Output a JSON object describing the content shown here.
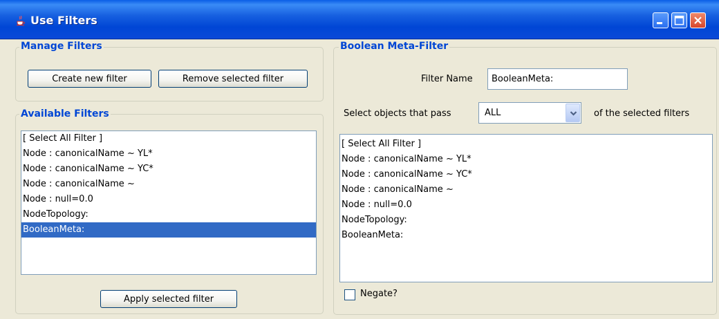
{
  "window": {
    "title": "Use Filters"
  },
  "manage_filters": {
    "title": "Manage Filters",
    "create_label": "Create new filter",
    "remove_label": "Remove selected filter"
  },
  "available_filters": {
    "title": "Available Filters",
    "items": [
      "[ Select All Filter ]",
      "Node : canonicalName ~ YL*",
      "Node : canonicalName ~ YC*",
      "Node : canonicalName ~",
      "Node : null=0.0",
      "NodeTopology:",
      "BooleanMeta:"
    ],
    "selected_item": "BooleanMeta:",
    "apply_label": "Apply selected filter"
  },
  "boolean_meta": {
    "title": "Boolean Meta-Filter",
    "filter_name_label": "Filter Name",
    "filter_name_value": "BooleanMeta:",
    "select_prefix": "Select objects that pass",
    "select_value": "ALL",
    "select_suffix": "of the selected filters",
    "items": [
      "[ Select All Filter ]",
      "Node : canonicalName ~ YL*",
      "Node : canonicalName ~ YC*",
      "Node : canonicalName ~",
      "Node : null=0.0",
      "NodeTopology:",
      "BooleanMeta:"
    ],
    "negate_label": "Negate?",
    "negate_checked": false
  },
  "colors": {
    "titlebar": "#0a49d8",
    "panel_title": "#0046d5",
    "selection": "#316ac5",
    "window_bg": "#ece9d8"
  },
  "icons": [
    "java-cup-icon",
    "minimize-icon",
    "maximize-icon",
    "close-icon",
    "chevron-down-icon"
  ]
}
